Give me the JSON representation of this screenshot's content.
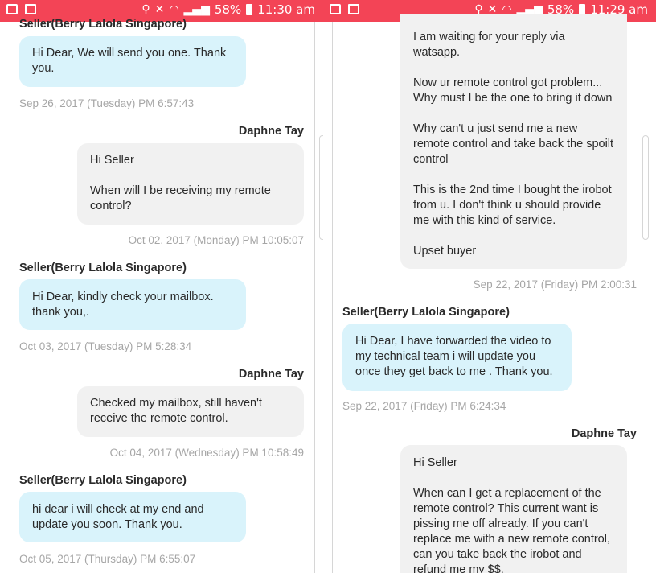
{
  "left": {
    "status": {
      "battery": "58%",
      "time": "11:30 am"
    },
    "messages": [
      {
        "sender": "Seller(Berry Lalola Singapore)",
        "text": "Hi Dear, We will send you one. Thank you.",
        "time": "Sep 26, 2017 (Tuesday) PM 6:57:43"
      },
      {
        "sender": "Daphne Tay",
        "text": "Hi Seller\n\nWhen will I be receiving my remote control?",
        "time": "Oct 02, 2017 (Monday) PM 10:05:07"
      },
      {
        "sender": "Seller(Berry Lalola Singapore)",
        "text": "Hi Dear, kindly check your mailbox. thank you,.",
        "time": "Oct 03, 2017 (Tuesday) PM 5:28:34"
      },
      {
        "sender": "Daphne Tay",
        "text": "Checked my mailbox, still haven't receive the remote control.",
        "time": "Oct 04, 2017 (Wednesday) PM 10:58:49"
      },
      {
        "sender": "Seller(Berry Lalola Singapore)",
        "text": "hi dear i will check at my end and update you soon. Thank you.",
        "time": "Oct 05, 2017 (Thursday) PM 6:55:07"
      }
    ]
  },
  "right": {
    "status": {
      "battery": "58%",
      "time": "11:29 am"
    },
    "messages": [
      {
        "sender": "",
        "text": "I am waiting for your reply via watsapp.\n\nNow ur remote control got problem... Why must I be the one to bring it down\n\nWhy can't u just send me a new remote control and take back the spoilt control\n\nThis is the 2nd time I bought the irobot from u. I don't think u should provide me with this kind of service.\n\nUpset buyer",
        "time": "Sep 22, 2017 (Friday) PM 2:00:31"
      },
      {
        "sender": "Seller(Berry Lalola Singapore)",
        "text": "Hi Dear, I have forwarded the video to my technical team i will update you once they get back to me . Thank you.",
        "time": "Sep 22, 2017 (Friday) PM 6:24:34"
      },
      {
        "sender": "Daphne Tay",
        "text": "Hi Seller\n\nWhen can I get a replacement of the remote control? This current want is pissing me off already. If you can't replace me with a new remote control, can you take back the irobot and refund me my $$.",
        "time": ""
      }
    ]
  }
}
